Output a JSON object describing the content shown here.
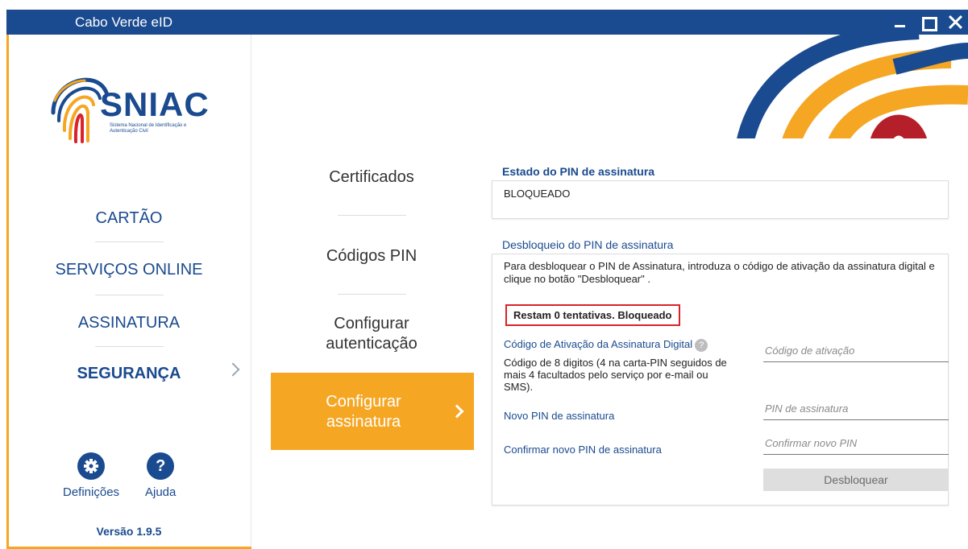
{
  "window": {
    "title": "Cabo Verde eID",
    "colors": {
      "primary": "#1a4a8f",
      "accent": "#f5a623",
      "alert": "#d9222a"
    }
  },
  "logo": {
    "name": "SNIAC",
    "subtitle": "Sistema Nacional de Identificação e Autenticação Civil"
  },
  "sidebar": {
    "items": [
      {
        "label": "CARTÃO"
      },
      {
        "label": "SERVIÇOS ONLINE"
      },
      {
        "label": "ASSINATURA"
      },
      {
        "label": "SEGURANÇA",
        "active": true
      }
    ],
    "settings_label": "Definições",
    "help_label": "Ajuda",
    "help_glyph": "?",
    "version": "Versão 1.9.5"
  },
  "submenu": {
    "items": [
      {
        "label": "Certificados"
      },
      {
        "label": "Códigos PIN"
      },
      {
        "label": "Configurar autenticação"
      },
      {
        "label": "Configurar assinatura",
        "active": true
      }
    ]
  },
  "signature_pin": {
    "status_title": "Estado do PIN de assinatura",
    "status_value": "BLOQUEADO",
    "unlock_title": "Desbloqueio do PIN de assinatura",
    "description": "Para desbloquear o PIN de Assinatura, introduza o código de ativação da assinatura digital e clique no botão \"Desbloquear\" .",
    "attempts_warning": "Restam 0 tentativas. Bloqueado",
    "activation_code_label": "Código de Ativação da Assinatura Digital",
    "activation_code_help": "Código de 8 digitos (4 na carta-PIN seguidos de mais 4 facultados pelo serviço por e-mail ou SMS).",
    "activation_code_placeholder": "Código de ativação",
    "new_pin_label": "Novo PIN de assinatura",
    "new_pin_placeholder": "PIN de assinatura",
    "confirm_pin_label": "Confirmar novo PIN de assinatura",
    "confirm_pin_placeholder": "Confirmar novo PIN",
    "unlock_button": "Desbloquear"
  }
}
